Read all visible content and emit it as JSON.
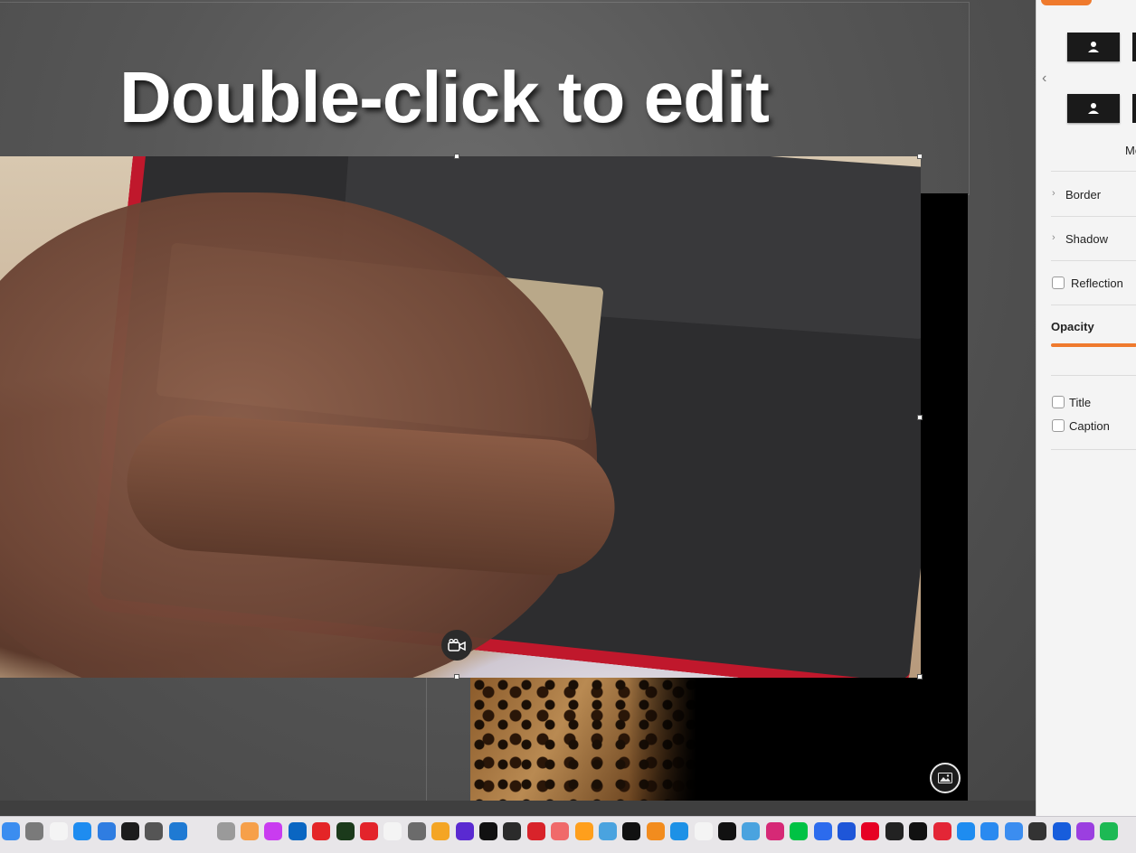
{
  "slide": {
    "title_text": "Double-click to edit"
  },
  "inspector": {
    "more_label": "Mo",
    "sections": {
      "border": "Border",
      "shadow": "Shadow",
      "reflection": "Reflection",
      "opacity": "Opacity",
      "title": "Title",
      "caption": "Caption"
    }
  },
  "colors": {
    "accent": "#ef7a2d",
    "video_frame": "#c0182c"
  },
  "icons": {
    "video_badge": "video-camera-icon",
    "photo_badge": "image-icon",
    "back": "chevron-left-icon"
  },
  "dock": {
    "apps": [
      {
        "name": "finder-icon",
        "color": "#3b8df0"
      },
      {
        "name": "drive-icon",
        "color": "#7a7a7a"
      },
      {
        "name": "reminders-icon",
        "color": "#f4f4f4"
      },
      {
        "name": "app-store-icon",
        "color": "#1e8cf0"
      },
      {
        "name": "xcode-icon",
        "color": "#2f7de1"
      },
      {
        "name": "terminal-icon",
        "color": "#1c1c1c"
      },
      {
        "name": "checkers-icon",
        "color": "#555555"
      },
      {
        "name": "vscode-icon",
        "color": "#1f7ad3"
      },
      {
        "name": "spacer-icon",
        "color": "#e8e6e9"
      },
      {
        "name": "printer-icon",
        "color": "#9a9a9a"
      },
      {
        "name": "pages-icon",
        "color": "#f6a04a"
      },
      {
        "name": "picsart-icon",
        "color": "#c93cf0"
      },
      {
        "name": "linkedin-icon",
        "color": "#0a66c2"
      },
      {
        "name": "zoho-icon",
        "color": "#e42527"
      },
      {
        "name": "activity-icon",
        "color": "#1b3a1b"
      },
      {
        "name": "acrobat-icon",
        "color": "#e3242b"
      },
      {
        "name": "ubar-icon",
        "color": "#f4f4f4"
      },
      {
        "name": "server-icon",
        "color": "#6b6b6b"
      },
      {
        "name": "warning-icon",
        "color": "#f4a524"
      },
      {
        "name": "orb-icon",
        "color": "#5a2ad1"
      },
      {
        "name": "x-icon",
        "color": "#111111"
      },
      {
        "name": "teams-icon",
        "color": "#2b2b2b"
      },
      {
        "name": "pdf-icon",
        "color": "#d8232a"
      },
      {
        "name": "asana-icon",
        "color": "#f06a6a"
      },
      {
        "name": "pencil-icon",
        "color": "#ff9f1c"
      },
      {
        "name": "wrench-icon",
        "color": "#4aa3df"
      },
      {
        "name": "tiktok-icon",
        "color": "#111111"
      },
      {
        "name": "sublime-icon",
        "color": "#f28c1e"
      },
      {
        "name": "docker-icon",
        "color": "#1d91e6"
      },
      {
        "name": "chatgpt-icon",
        "color": "#f4f4f4"
      },
      {
        "name": "tidal-icon",
        "color": "#111111"
      },
      {
        "name": "phone-icon",
        "color": "#4aa3df"
      },
      {
        "name": "instagram-icon",
        "color": "#d62976"
      },
      {
        "name": "cashapp-icon",
        "color": "#00c244"
      },
      {
        "name": "signal-icon",
        "color": "#2c6bed"
      },
      {
        "name": "altstore-icon",
        "color": "#1e56d8"
      },
      {
        "name": "pinterest-icon",
        "color": "#e60023"
      },
      {
        "name": "dots-icon",
        "color": "#222222"
      },
      {
        "name": "arc-icon",
        "color": "#111111"
      },
      {
        "name": "shield-icon",
        "color": "#e32636"
      },
      {
        "name": "safari-icon",
        "color": "#1e8cf0"
      },
      {
        "name": "xcode2-icon",
        "color": "#2a8af0"
      },
      {
        "name": "defender-icon",
        "color": "#3b8df0"
      },
      {
        "name": "qr-icon",
        "color": "#333333"
      },
      {
        "name": "bitwarden-icon",
        "color": "#175ddc"
      },
      {
        "name": "podcasts-icon",
        "color": "#9b3fe0"
      },
      {
        "name": "spotify-icon",
        "color": "#1db954"
      }
    ]
  }
}
